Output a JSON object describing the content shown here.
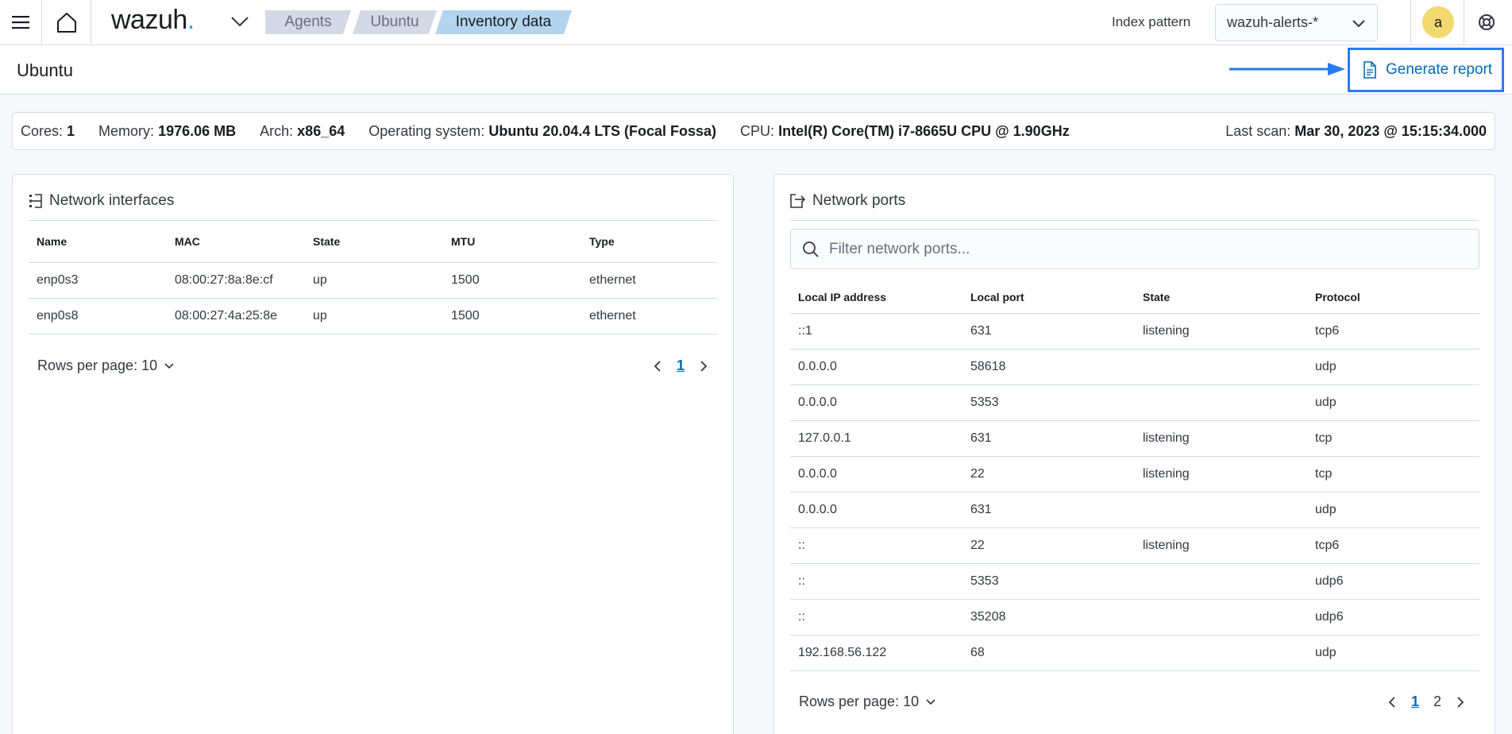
{
  "header": {
    "logo": "wazuh",
    "logo_dot": ".",
    "breadcrumbs": [
      "Agents",
      "Ubuntu",
      "Inventory data"
    ],
    "index_pattern_label": "Index pattern",
    "index_pattern_value": "wazuh-alerts-*",
    "avatar_initial": "a"
  },
  "page": {
    "title": "Ubuntu",
    "generate_report": "Generate report"
  },
  "info": {
    "cores_label": "Cores:",
    "cores": "1",
    "memory_label": "Memory:",
    "memory": "1976.06 MB",
    "arch_label": "Arch:",
    "arch": "x86_64",
    "os_label": "Operating system:",
    "os": "Ubuntu 20.04.4 LTS (Focal Fossa)",
    "cpu_label": "CPU:",
    "cpu": "Intel(R) Core(TM) i7-8665U CPU @ 1.90GHz",
    "last_scan_label": "Last scan:",
    "last_scan": "Mar 30, 2023 @ 15:15:34.000"
  },
  "interfaces": {
    "title": "Network interfaces",
    "columns": [
      "Name",
      "MAC",
      "State",
      "MTU",
      "Type"
    ],
    "rows": [
      [
        "enp0s3",
        "08:00:27:8a:8e:cf",
        "up",
        "1500",
        "ethernet"
      ],
      [
        "enp0s8",
        "08:00:27:4a:25:8e",
        "up",
        "1500",
        "ethernet"
      ]
    ],
    "rows_per_page": "Rows per page: 10",
    "pages": [
      "1"
    ]
  },
  "ports": {
    "title": "Network ports",
    "search_placeholder": "Filter network ports...",
    "columns": [
      "Local IP address",
      "Local port",
      "State",
      "Protocol"
    ],
    "rows": [
      [
        "::1",
        "631",
        "listening",
        "tcp6"
      ],
      [
        "0.0.0.0",
        "58618",
        "",
        "udp"
      ],
      [
        "0.0.0.0",
        "5353",
        "",
        "udp"
      ],
      [
        "127.0.0.1",
        "631",
        "listening",
        "tcp"
      ],
      [
        "0.0.0.0",
        "22",
        "listening",
        "tcp"
      ],
      [
        "0.0.0.0",
        "631",
        "",
        "udp"
      ],
      [
        "::",
        "22",
        "listening",
        "tcp6"
      ],
      [
        "::",
        "5353",
        "",
        "udp6"
      ],
      [
        "::",
        "35208",
        "",
        "udp6"
      ],
      [
        "192.168.56.122",
        "68",
        "",
        "udp"
      ]
    ],
    "rows_per_page": "Rows per page: 10",
    "pages": [
      "1",
      "2"
    ]
  },
  "colors": {
    "accent": "#006bb8",
    "report_highlight": "#2b7bf0",
    "avatar": "#f1d86f",
    "breadcrumb_active": "#b3d4ee",
    "breadcrumb_inactive": "#d3dae6"
  },
  "icons": [
    "menu-icon",
    "home-icon",
    "chevron-down-icon",
    "help-icon",
    "document-icon",
    "arrow-right-icon",
    "network-interfaces-icon",
    "network-ports-icon",
    "search-icon",
    "chevron-left-icon",
    "chevron-right-icon"
  ]
}
